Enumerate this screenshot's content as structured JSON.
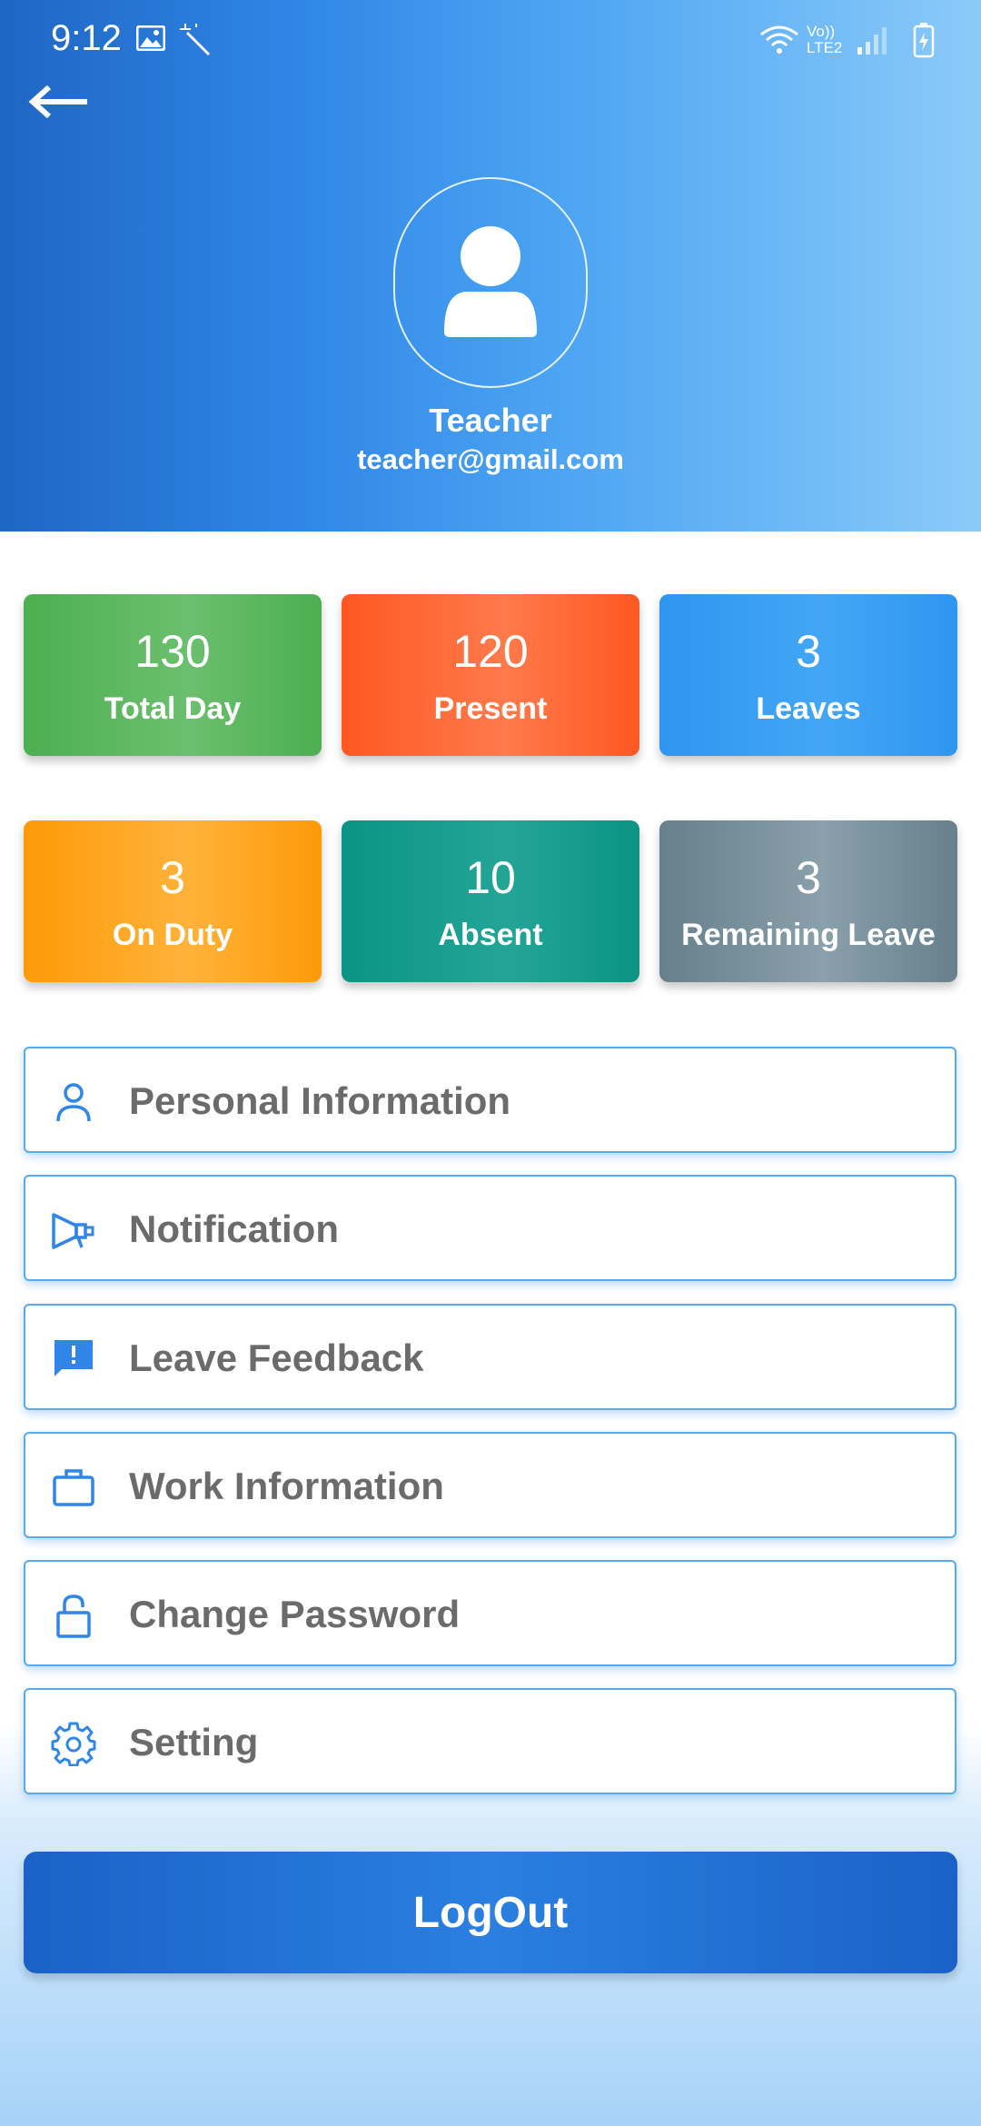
{
  "status_bar": {
    "time": "9:12",
    "network": "Vo)) LTE2"
  },
  "profile": {
    "name": "Teacher",
    "email": "teacher@gmail.com"
  },
  "stats": [
    {
      "value": "130",
      "label": "Total Day",
      "color": "#4caf50"
    },
    {
      "value": "120",
      "label": "Present",
      "color": "#ff5722"
    },
    {
      "value": "3",
      "label": "Leaves",
      "color": "#2e96f0"
    },
    {
      "value": "3",
      "label": "On Duty",
      "color": "#fd9a08"
    },
    {
      "value": "10",
      "label": "Absent",
      "color": "#0b9384"
    },
    {
      "value": "3",
      "label": "Remaining Leave",
      "color": "#66808c"
    }
  ],
  "menu": [
    {
      "label": "Personal Information",
      "icon": "person-icon"
    },
    {
      "label": "Notification",
      "icon": "megaphone-icon"
    },
    {
      "label": "Leave Feedback",
      "icon": "feedback-icon"
    },
    {
      "label": "Work Information",
      "icon": "briefcase-icon"
    },
    {
      "label": "Change Password",
      "icon": "lock-icon"
    },
    {
      "label": "Setting",
      "icon": "gear-icon"
    }
  ],
  "logout_label": "LogOut",
  "colors": {
    "accent": "#1a62c7",
    "menu_icon": "#2f86e6",
    "menu_text": "#6b6b6b"
  }
}
